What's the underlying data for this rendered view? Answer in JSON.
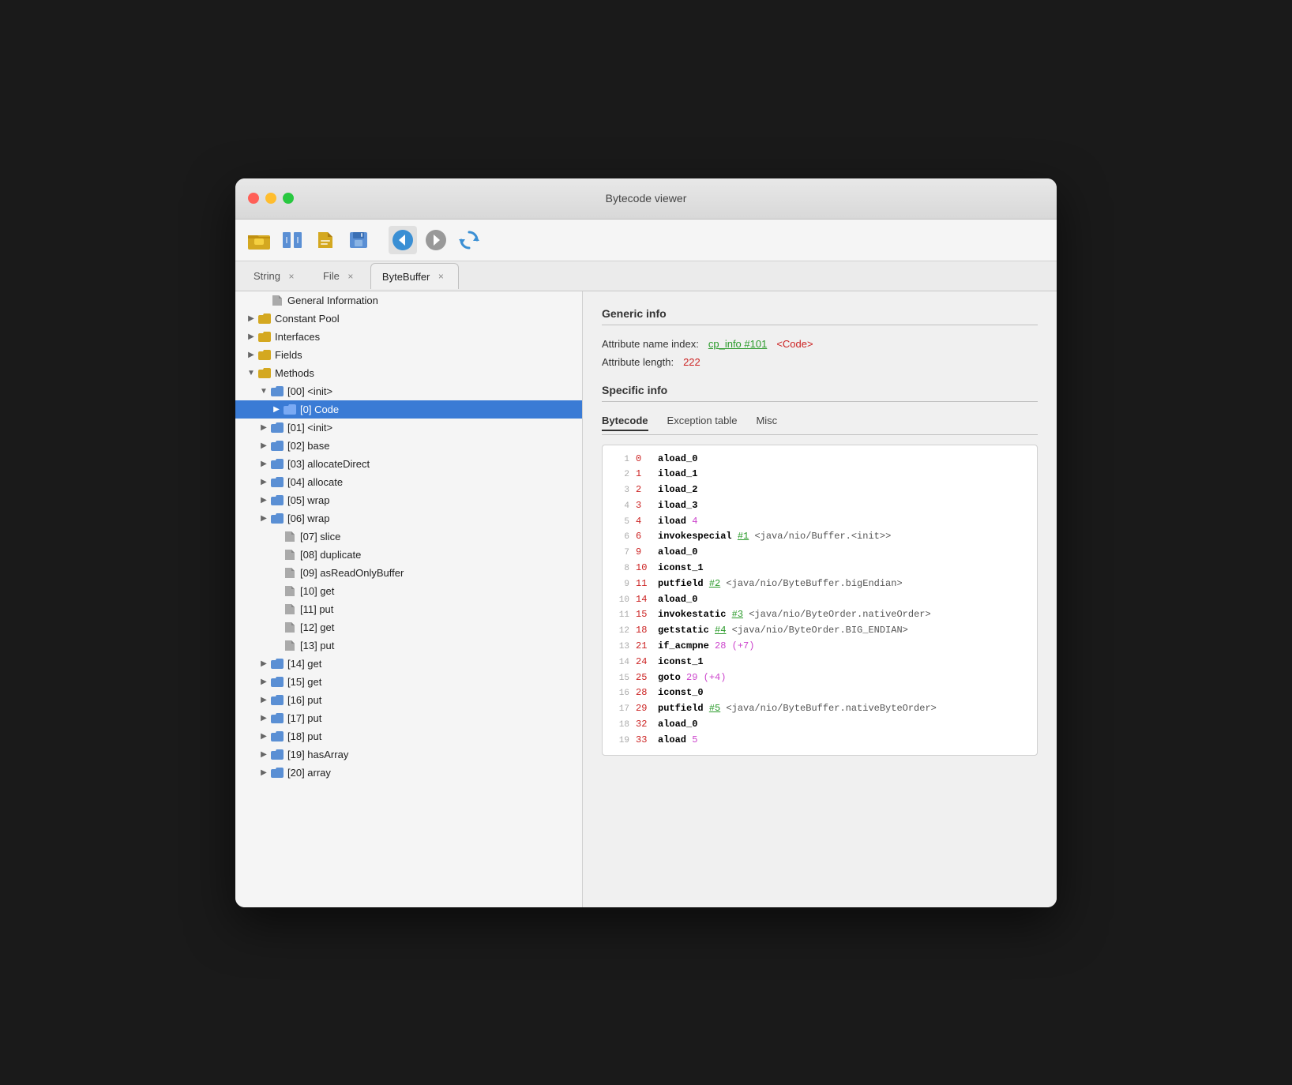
{
  "window": {
    "title": "Bytecode viewer"
  },
  "toolbar": {
    "buttons": [
      {
        "name": "open-jar",
        "icon": "📦"
      },
      {
        "name": "open-class",
        "icon": "🔲"
      },
      {
        "name": "open-file",
        "icon": "📂"
      },
      {
        "name": "save",
        "icon": "💾"
      },
      {
        "name": "back",
        "icon": "◀"
      },
      {
        "name": "forward",
        "icon": "⚫"
      },
      {
        "name": "refresh",
        "icon": "🔄"
      }
    ]
  },
  "tabs": [
    {
      "label": "String",
      "active": false
    },
    {
      "label": "File",
      "active": false
    },
    {
      "label": "ByteBuffer",
      "active": true
    }
  ],
  "sidebar": {
    "items": [
      {
        "id": "general-info",
        "label": "General Information",
        "type": "file",
        "indent": 0,
        "expanded": false
      },
      {
        "id": "constant-pool",
        "label": "Constant Pool",
        "type": "folder",
        "indent": 0,
        "expanded": false,
        "arrow": "▶"
      },
      {
        "id": "interfaces",
        "label": "Interfaces",
        "type": "folder",
        "indent": 0,
        "expanded": false,
        "arrow": "▶"
      },
      {
        "id": "fields",
        "label": "Fields",
        "type": "folder",
        "indent": 0,
        "expanded": false,
        "arrow": "▶"
      },
      {
        "id": "methods",
        "label": "Methods",
        "type": "folder",
        "indent": 0,
        "expanded": true,
        "arrow": "▼"
      },
      {
        "id": "method-00",
        "label": "[00] <init>",
        "type": "folder",
        "indent": 1,
        "expanded": true,
        "arrow": "▼"
      },
      {
        "id": "method-00-code",
        "label": "[0] Code",
        "type": "folder",
        "indent": 2,
        "expanded": false,
        "arrow": "▶",
        "selected": true
      },
      {
        "id": "method-01",
        "label": "[01] <init>",
        "type": "folder",
        "indent": 1,
        "expanded": false,
        "arrow": "▶"
      },
      {
        "id": "method-02",
        "label": "[02] base",
        "type": "folder",
        "indent": 1,
        "expanded": false,
        "arrow": "▶"
      },
      {
        "id": "method-03",
        "label": "[03] allocateDirect",
        "type": "folder",
        "indent": 1,
        "expanded": false,
        "arrow": "▶"
      },
      {
        "id": "method-04",
        "label": "[04] allocate",
        "type": "folder",
        "indent": 1,
        "expanded": false,
        "arrow": "▶"
      },
      {
        "id": "method-05",
        "label": "[05] wrap",
        "type": "folder",
        "indent": 1,
        "expanded": false,
        "arrow": "▶"
      },
      {
        "id": "method-06",
        "label": "[06] wrap",
        "type": "folder",
        "indent": 1,
        "expanded": false,
        "arrow": "▶"
      },
      {
        "id": "method-07",
        "label": "[07] slice",
        "type": "file",
        "indent": 1
      },
      {
        "id": "method-08",
        "label": "[08] duplicate",
        "type": "file",
        "indent": 1
      },
      {
        "id": "method-09",
        "label": "[09] asReadOnlyBuffer",
        "type": "file",
        "indent": 1
      },
      {
        "id": "method-10",
        "label": "[10] get",
        "type": "file",
        "indent": 1
      },
      {
        "id": "method-11",
        "label": "[11] put",
        "type": "file",
        "indent": 1
      },
      {
        "id": "method-12",
        "label": "[12] get",
        "type": "file",
        "indent": 1
      },
      {
        "id": "method-13",
        "label": "[13] put",
        "type": "file",
        "indent": 1
      },
      {
        "id": "method-14",
        "label": "[14] get",
        "type": "folder",
        "indent": 1,
        "expanded": false,
        "arrow": "▶"
      },
      {
        "id": "method-15",
        "label": "[15] get",
        "type": "folder",
        "indent": 1,
        "expanded": false,
        "arrow": "▶"
      },
      {
        "id": "method-16",
        "label": "[16] put",
        "type": "folder",
        "indent": 1,
        "expanded": false,
        "arrow": "▶"
      },
      {
        "id": "method-17",
        "label": "[17] put",
        "type": "folder",
        "indent": 1,
        "expanded": false,
        "arrow": "▶"
      },
      {
        "id": "method-18",
        "label": "[18] put",
        "type": "folder",
        "indent": 1,
        "expanded": false,
        "arrow": "▶"
      },
      {
        "id": "method-19",
        "label": "[19] hasArray",
        "type": "folder",
        "indent": 1,
        "expanded": false,
        "arrow": "▶"
      },
      {
        "id": "method-20",
        "label": "[20] array",
        "type": "folder",
        "indent": 1,
        "expanded": false,
        "arrow": "▶"
      }
    ]
  },
  "content": {
    "generic_info": {
      "title": "Generic info",
      "attr_name_label": "Attribute name index:",
      "attr_name_value_green": "cp_info #101",
      "attr_name_value_red": "<Code>",
      "attr_length_label": "Attribute length:",
      "attr_length_value": "222"
    },
    "specific_info": {
      "title": "Specific info",
      "tabs": [
        "Bytecode",
        "Exception table",
        "Misc"
      ],
      "active_tab": "Bytecode"
    },
    "bytecode": [
      {
        "line": 1,
        "op": 0,
        "mnemonic": "aload_0",
        "args": ""
      },
      {
        "line": 2,
        "op": 1,
        "mnemonic": "iload_1",
        "args": ""
      },
      {
        "line": 3,
        "op": 2,
        "mnemonic": "iload_2",
        "args": ""
      },
      {
        "line": 4,
        "op": 3,
        "mnemonic": "iload_3",
        "args": ""
      },
      {
        "line": 5,
        "op": 4,
        "mnemonic": "iload",
        "literal": "4"
      },
      {
        "line": 6,
        "op": 6,
        "mnemonic": "invokespecial",
        "ref": "#1",
        "comment": "<java/nio/Buffer.<init>>"
      },
      {
        "line": 7,
        "op": 9,
        "mnemonic": "aload_0",
        "args": ""
      },
      {
        "line": 8,
        "op": 10,
        "mnemonic": "iconst_1",
        "args": ""
      },
      {
        "line": 9,
        "op": 11,
        "mnemonic": "putfield",
        "ref": "#2",
        "comment": "<java/nio/ByteBuffer.bigEndian>"
      },
      {
        "line": 10,
        "op": 14,
        "mnemonic": "aload_0",
        "args": ""
      },
      {
        "line": 11,
        "op": 15,
        "mnemonic": "invokestatic",
        "ref": "#3",
        "comment": "<java/nio/ByteOrder.nativeOrder>"
      },
      {
        "line": 12,
        "op": 18,
        "mnemonic": "getstatic",
        "ref": "#4",
        "comment": "<java/nio/ByteOrder.BIG_ENDIAN>"
      },
      {
        "line": 13,
        "op": 21,
        "mnemonic": "if_acmpne",
        "offset": "28",
        "literal": "(+7)"
      },
      {
        "line": 14,
        "op": 24,
        "mnemonic": "iconst_1",
        "args": ""
      },
      {
        "line": 15,
        "op": 25,
        "mnemonic": "goto",
        "offset": "29",
        "literal": "(+4)"
      },
      {
        "line": 16,
        "op": 28,
        "mnemonic": "iconst_0",
        "args": ""
      },
      {
        "line": 17,
        "op": 29,
        "mnemonic": "putfield",
        "ref": "#5",
        "comment": "<java/nio/ByteBuffer.nativeByteOrder>"
      },
      {
        "line": 18,
        "op": 32,
        "mnemonic": "aload_0",
        "args": ""
      },
      {
        "line": 19,
        "op": 33,
        "mnemonic": "aload",
        "literal": "5"
      }
    ]
  }
}
